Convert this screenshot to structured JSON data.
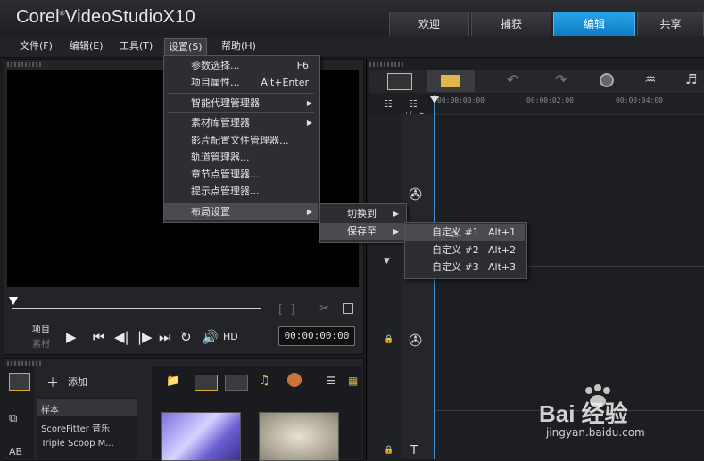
{
  "app": {
    "brand_main": "Corel",
    "brand_product": "VideoStudio",
    "brand_version": "X10",
    "tabs": [
      "欢迎",
      "捕获",
      "编辑",
      "共享"
    ],
    "active_tab": "编辑"
  },
  "menubar": {
    "items": [
      "文件(F)",
      "编辑(E)",
      "工具(T)",
      "设置(S)",
      "帮助(H)"
    ]
  },
  "settings_menu": {
    "items": [
      {
        "label": "参数选择...",
        "shortcut": "F6"
      },
      {
        "label": "项目属性...",
        "shortcut": "Alt+Enter"
      },
      {
        "label": "智能代理管理器",
        "shortcut": ""
      },
      {
        "label": "素材库管理器",
        "shortcut": ""
      },
      {
        "label": "影片配置文件管理器...",
        "shortcut": ""
      },
      {
        "label": "轨道管理器...",
        "shortcut": ""
      },
      {
        "label": "章节点管理器...",
        "shortcut": ""
      },
      {
        "label": "提示点管理器...",
        "shortcut": ""
      },
      {
        "label": "布局设置",
        "shortcut": ""
      }
    ]
  },
  "layout_menu": {
    "items": [
      "切换到",
      "保存至"
    ]
  },
  "save_menu": {
    "items": [
      {
        "label": "自定义 #1",
        "shortcut": "Alt+1"
      },
      {
        "label": "自定义 #2",
        "shortcut": "Alt+2"
      },
      {
        "label": "自定义 #3",
        "shortcut": "Alt+3"
      }
    ]
  },
  "preview": {
    "label_project": "项目",
    "label_clip": "素材",
    "hd": "HD",
    "timecode": "00:00:00:00"
  },
  "timeline": {
    "ticks": [
      "00:00:00:00",
      "00:00:02:00",
      "00:00:04:00"
    ]
  },
  "library": {
    "add_label": "添加",
    "items": [
      "样本",
      "ScoreFitter 音乐",
      "Triple Scoop M..."
    ]
  },
  "watermark": {
    "text": "Bai 经验",
    "url": "jingyan.baidu.com"
  }
}
